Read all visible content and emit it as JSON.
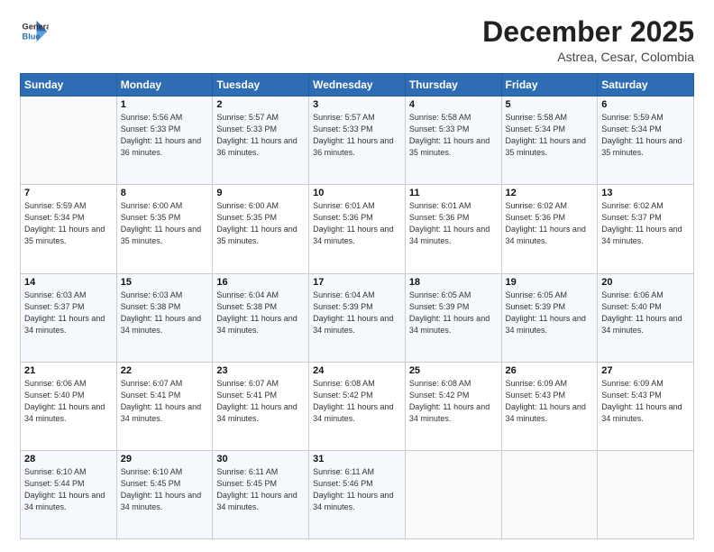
{
  "logo": {
    "line1": "General",
    "line2": "Blue"
  },
  "title": "December 2025",
  "subtitle": "Astrea, Cesar, Colombia",
  "header_days": [
    "Sunday",
    "Monday",
    "Tuesday",
    "Wednesday",
    "Thursday",
    "Friday",
    "Saturday"
  ],
  "weeks": [
    [
      {
        "day": "",
        "sunrise": "",
        "sunset": "",
        "daylight": ""
      },
      {
        "day": "1",
        "sunrise": "Sunrise: 5:56 AM",
        "sunset": "Sunset: 5:33 PM",
        "daylight": "Daylight: 11 hours and 36 minutes."
      },
      {
        "day": "2",
        "sunrise": "Sunrise: 5:57 AM",
        "sunset": "Sunset: 5:33 PM",
        "daylight": "Daylight: 11 hours and 36 minutes."
      },
      {
        "day": "3",
        "sunrise": "Sunrise: 5:57 AM",
        "sunset": "Sunset: 5:33 PM",
        "daylight": "Daylight: 11 hours and 36 minutes."
      },
      {
        "day": "4",
        "sunrise": "Sunrise: 5:58 AM",
        "sunset": "Sunset: 5:33 PM",
        "daylight": "Daylight: 11 hours and 35 minutes."
      },
      {
        "day": "5",
        "sunrise": "Sunrise: 5:58 AM",
        "sunset": "Sunset: 5:34 PM",
        "daylight": "Daylight: 11 hours and 35 minutes."
      },
      {
        "day": "6",
        "sunrise": "Sunrise: 5:59 AM",
        "sunset": "Sunset: 5:34 PM",
        "daylight": "Daylight: 11 hours and 35 minutes."
      }
    ],
    [
      {
        "day": "7",
        "sunrise": "Sunrise: 5:59 AM",
        "sunset": "Sunset: 5:34 PM",
        "daylight": "Daylight: 11 hours and 35 minutes."
      },
      {
        "day": "8",
        "sunrise": "Sunrise: 6:00 AM",
        "sunset": "Sunset: 5:35 PM",
        "daylight": "Daylight: 11 hours and 35 minutes."
      },
      {
        "day": "9",
        "sunrise": "Sunrise: 6:00 AM",
        "sunset": "Sunset: 5:35 PM",
        "daylight": "Daylight: 11 hours and 35 minutes."
      },
      {
        "day": "10",
        "sunrise": "Sunrise: 6:01 AM",
        "sunset": "Sunset: 5:36 PM",
        "daylight": "Daylight: 11 hours and 34 minutes."
      },
      {
        "day": "11",
        "sunrise": "Sunrise: 6:01 AM",
        "sunset": "Sunset: 5:36 PM",
        "daylight": "Daylight: 11 hours and 34 minutes."
      },
      {
        "day": "12",
        "sunrise": "Sunrise: 6:02 AM",
        "sunset": "Sunset: 5:36 PM",
        "daylight": "Daylight: 11 hours and 34 minutes."
      },
      {
        "day": "13",
        "sunrise": "Sunrise: 6:02 AM",
        "sunset": "Sunset: 5:37 PM",
        "daylight": "Daylight: 11 hours and 34 minutes."
      }
    ],
    [
      {
        "day": "14",
        "sunrise": "Sunrise: 6:03 AM",
        "sunset": "Sunset: 5:37 PM",
        "daylight": "Daylight: 11 hours and 34 minutes."
      },
      {
        "day": "15",
        "sunrise": "Sunrise: 6:03 AM",
        "sunset": "Sunset: 5:38 PM",
        "daylight": "Daylight: 11 hours and 34 minutes."
      },
      {
        "day": "16",
        "sunrise": "Sunrise: 6:04 AM",
        "sunset": "Sunset: 5:38 PM",
        "daylight": "Daylight: 11 hours and 34 minutes."
      },
      {
        "day": "17",
        "sunrise": "Sunrise: 6:04 AM",
        "sunset": "Sunset: 5:39 PM",
        "daylight": "Daylight: 11 hours and 34 minutes."
      },
      {
        "day": "18",
        "sunrise": "Sunrise: 6:05 AM",
        "sunset": "Sunset: 5:39 PM",
        "daylight": "Daylight: 11 hours and 34 minutes."
      },
      {
        "day": "19",
        "sunrise": "Sunrise: 6:05 AM",
        "sunset": "Sunset: 5:39 PM",
        "daylight": "Daylight: 11 hours and 34 minutes."
      },
      {
        "day": "20",
        "sunrise": "Sunrise: 6:06 AM",
        "sunset": "Sunset: 5:40 PM",
        "daylight": "Daylight: 11 hours and 34 minutes."
      }
    ],
    [
      {
        "day": "21",
        "sunrise": "Sunrise: 6:06 AM",
        "sunset": "Sunset: 5:40 PM",
        "daylight": "Daylight: 11 hours and 34 minutes."
      },
      {
        "day": "22",
        "sunrise": "Sunrise: 6:07 AM",
        "sunset": "Sunset: 5:41 PM",
        "daylight": "Daylight: 11 hours and 34 minutes."
      },
      {
        "day": "23",
        "sunrise": "Sunrise: 6:07 AM",
        "sunset": "Sunset: 5:41 PM",
        "daylight": "Daylight: 11 hours and 34 minutes."
      },
      {
        "day": "24",
        "sunrise": "Sunrise: 6:08 AM",
        "sunset": "Sunset: 5:42 PM",
        "daylight": "Daylight: 11 hours and 34 minutes."
      },
      {
        "day": "25",
        "sunrise": "Sunrise: 6:08 AM",
        "sunset": "Sunset: 5:42 PM",
        "daylight": "Daylight: 11 hours and 34 minutes."
      },
      {
        "day": "26",
        "sunrise": "Sunrise: 6:09 AM",
        "sunset": "Sunset: 5:43 PM",
        "daylight": "Daylight: 11 hours and 34 minutes."
      },
      {
        "day": "27",
        "sunrise": "Sunrise: 6:09 AM",
        "sunset": "Sunset: 5:43 PM",
        "daylight": "Daylight: 11 hours and 34 minutes."
      }
    ],
    [
      {
        "day": "28",
        "sunrise": "Sunrise: 6:10 AM",
        "sunset": "Sunset: 5:44 PM",
        "daylight": "Daylight: 11 hours and 34 minutes."
      },
      {
        "day": "29",
        "sunrise": "Sunrise: 6:10 AM",
        "sunset": "Sunset: 5:45 PM",
        "daylight": "Daylight: 11 hours and 34 minutes."
      },
      {
        "day": "30",
        "sunrise": "Sunrise: 6:11 AM",
        "sunset": "Sunset: 5:45 PM",
        "daylight": "Daylight: 11 hours and 34 minutes."
      },
      {
        "day": "31",
        "sunrise": "Sunrise: 6:11 AM",
        "sunset": "Sunset: 5:46 PM",
        "daylight": "Daylight: 11 hours and 34 minutes."
      },
      {
        "day": "",
        "sunrise": "",
        "sunset": "",
        "daylight": ""
      },
      {
        "day": "",
        "sunrise": "",
        "sunset": "",
        "daylight": ""
      },
      {
        "day": "",
        "sunrise": "",
        "sunset": "",
        "daylight": ""
      }
    ]
  ]
}
